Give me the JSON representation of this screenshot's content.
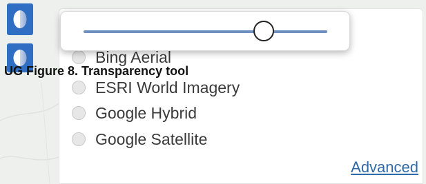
{
  "toolbar": {
    "buttons": [
      {
        "icon": "half-circle-icon"
      },
      {
        "icon": "half-circle-icon"
      }
    ]
  },
  "transparency_slider": {
    "value_percent": 74
  },
  "basemaps": {
    "items": [
      {
        "label": "Bing Aerial",
        "selected": false
      },
      {
        "label": "ESRI World Imagery",
        "selected": false
      },
      {
        "label": "Google Hybrid",
        "selected": false
      },
      {
        "label": "Google Satellite",
        "selected": false
      }
    ],
    "advanced_label": "Advanced"
  },
  "caption": {
    "text": "UG Figure 8. Transparency tool"
  },
  "colors": {
    "tool_button": "#2f6ec2",
    "slider_track": "#6f8fc0",
    "link": "#2e6aa8"
  }
}
